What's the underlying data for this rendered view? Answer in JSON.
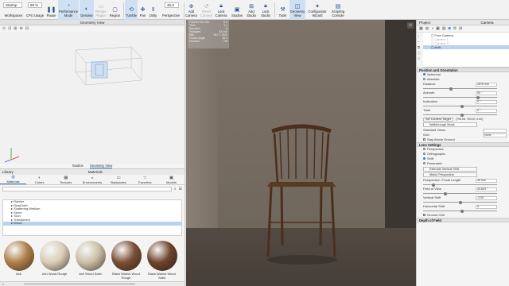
{
  "toolbar": {
    "workspace_value": "Startup",
    "workspaces_label": "Workspaces",
    "cpu_value": "89 %",
    "cpu_label": "CPU Usage",
    "pause_label": "Pause",
    "performance_mode_label": "Performance Mode",
    "denoise_label": "Denoise",
    "render_region_label": "Render Region",
    "region_label": "Region",
    "tumble_label": "Tumble",
    "pan_label": "Pan",
    "dolly_label": "Dolly",
    "fov_value": "45.0",
    "perspective_label": "Perspective",
    "add_camera_label": "Add Camera",
    "reset_camera_label": "Reset Camera",
    "lock_camera_label": "Lock Camera",
    "studios_label": "Studios",
    "add_studio_label": "Add Studio",
    "lock_studio_label": "Lock Studio",
    "tools_label": "Tools",
    "geometry_view_label": "Geometry View",
    "configurator_wizard_label": "Configurator Wizard",
    "scripting_console_label": "Scripting Console"
  },
  "geometry_view": {
    "title": "Geometry View",
    "tab_studios": "Studios",
    "tab_geometry_view": "Geometry View"
  },
  "library": {
    "title": "Library",
    "subtitle": "Materials",
    "tabs": [
      {
        "label": "Materials",
        "icon": "sphere-icon"
      },
      {
        "label": "Colors",
        "icon": "palette-icon"
      },
      {
        "label": "Textures",
        "icon": "texture-icon"
      },
      {
        "label": "Environments",
        "icon": "environment-icon"
      },
      {
        "label": "Backplates",
        "icon": "backplate-icon"
      },
      {
        "label": "Favorites",
        "icon": "star-icon"
      },
      {
        "label": "Models",
        "icon": "cube-icon"
      }
    ],
    "tree": [
      "Rubber",
      "RealCloth",
      "Scattering Medium",
      "Stone",
      "Toon",
      "Translucent",
      "Wood"
    ],
    "selected": "Wood",
    "swatches": [
      {
        "label": "Ash",
        "color": "#b0804a"
      },
      {
        "label": "Ash Wood Rough",
        "color": "#d9cdb6"
      },
      {
        "label": "Ash Wood Satin",
        "color": "#cbbfa6"
      },
      {
        "label": "Black Walnut Wood Rough",
        "color": "#7a4f35"
      },
      {
        "label": "Black Walnut Wood Satin",
        "color": "#6e432c"
      }
    ]
  },
  "viewport": {
    "stats": [
      {
        "k": "Frames Per Sec",
        "v": "0.0"
      },
      {
        "k": "Time",
        "v": "3.1"
      },
      {
        "k": "Samples",
        "v": "6"
      },
      {
        "k": "Triangles",
        "v": "43,444"
      },
      {
        "k": "Res",
        "v": "867 x 1920"
      },
      {
        "k": "Focal Length",
        "v": "45.0"
      },
      {
        "k": "Denoise",
        "v": "Off"
      }
    ]
  },
  "project": {
    "project_label": "Project",
    "camera_label": "Camera",
    "cameras": [
      {
        "label": "Free Camera",
        "state": "normal"
      },
      {
        "label": "Camera 1",
        "state": "dim"
      },
      {
        "label": "Camera 2",
        "state": "dim"
      },
      {
        "label": "shift",
        "state": "selected"
      }
    ],
    "position_section": "Position and Orientation",
    "spherical_label": "Spherical",
    "absolute_label": "Absolute",
    "distance_label": "Distance",
    "distance_value": "2876 mm",
    "azimuth_label": "Azimuth",
    "azimuth_value": "90 °",
    "inclination_label": "Inclination",
    "inclination_value": "0 °",
    "twist_label": "Twist",
    "twist_value": "0 °",
    "set_target_label": "Set Camera Target",
    "set_target_value": "(799.08, 750.00, 0.00)",
    "walkthrough_label": "Walkthrough Mode",
    "standard_views_label": "Standard Views",
    "standard_views_value": "-",
    "grid_label": "Grid",
    "grid_value": "None",
    "stay_above_ground_label": "Stay Above Ground",
    "lens_section": "Lens Settings",
    "perspective_label": "Perspective",
    "orthographic_label": "Orthographic",
    "shift_label": "Shift",
    "panoramic_label": "Panoramic",
    "estimate_shift_label": "Estimate Vertical Shift",
    "match_perspective_label": "Match Perspective",
    "perspective_focal_label": "Perspective / Focal Length",
    "perspective_focal_value": "45 mm",
    "fov_label": "Field of View",
    "fov_value": "43.603 °",
    "vertical_shift_label": "Vertical Shift",
    "vertical_shift_value": "-0.05",
    "horizontal_shift_label": "Horizontal Shift",
    "horizontal_shift_value": "0",
    "ground_grid_label": "Ground Grid",
    "dof_section": "Depth of Field"
  }
}
